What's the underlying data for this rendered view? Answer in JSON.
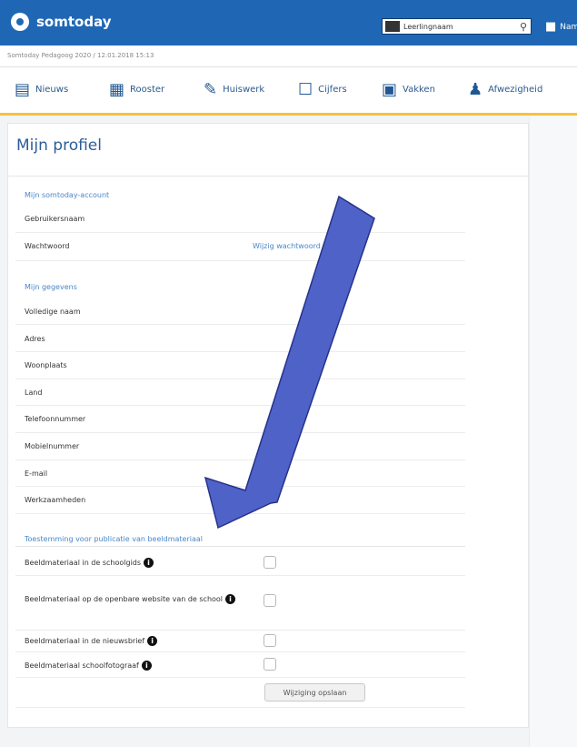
{
  "app": {
    "brand": "somtoday",
    "search": {
      "value": "Leerlingnaam"
    },
    "user": {
      "label": "Nam"
    }
  },
  "breadcrumb": "Somtoday Pedagoog 2020 / 12.01.2018 15:13",
  "nav": [
    {
      "label": "Nieuws",
      "icon": "news-icon"
    },
    {
      "label": "Rooster",
      "icon": "calendar-icon"
    },
    {
      "label": "Huiswerk",
      "icon": "pencil-icon"
    },
    {
      "label": "Cijfers",
      "icon": "grades-icon"
    },
    {
      "label": "Vakken",
      "icon": "books-icon"
    },
    {
      "label": "Afwezigheid",
      "icon": "person-icon"
    }
  ],
  "page": {
    "title": "Mijn profiel"
  },
  "account": {
    "heading": "Mijn somtoday-account",
    "rows": [
      {
        "label": "Gebruikersnaam",
        "value": ""
      },
      {
        "label": "Wachtwoord",
        "link": "Wijzig wachtwoord"
      }
    ]
  },
  "personal": {
    "heading": "Mijn gegevens",
    "rows": [
      {
        "label": "Volledige naam"
      },
      {
        "label": "Adres"
      },
      {
        "label": "Woonplaats"
      },
      {
        "label": "Land"
      },
      {
        "label": "Telefoonnummer"
      },
      {
        "label": "Mobielnummer"
      },
      {
        "label": "E-mail"
      },
      {
        "label": "Werkzaamheden"
      }
    ]
  },
  "permissions": {
    "heading": "Toestemming voor publicatie van beeldmateriaal",
    "rows": [
      {
        "label": "Beeldmateriaal in de schoolgids",
        "info": "i",
        "checked": false
      },
      {
        "label": "Beeldmateriaal op de openbare website van de school",
        "info": "i",
        "checked": false
      },
      {
        "label": "Beeldmateriaal in de nieuwsbrief",
        "info": "i",
        "checked": false
      },
      {
        "label": "Beeldmateriaal schoolfotograaf",
        "info": "i",
        "checked": false
      }
    ],
    "save_label": "Wijziging opslaan"
  },
  "colors": {
    "header": "#1f67b5",
    "accent_line": "#f7c23b",
    "arrow_fill": "#4f62c8",
    "arrow_stroke": "#26328a"
  }
}
